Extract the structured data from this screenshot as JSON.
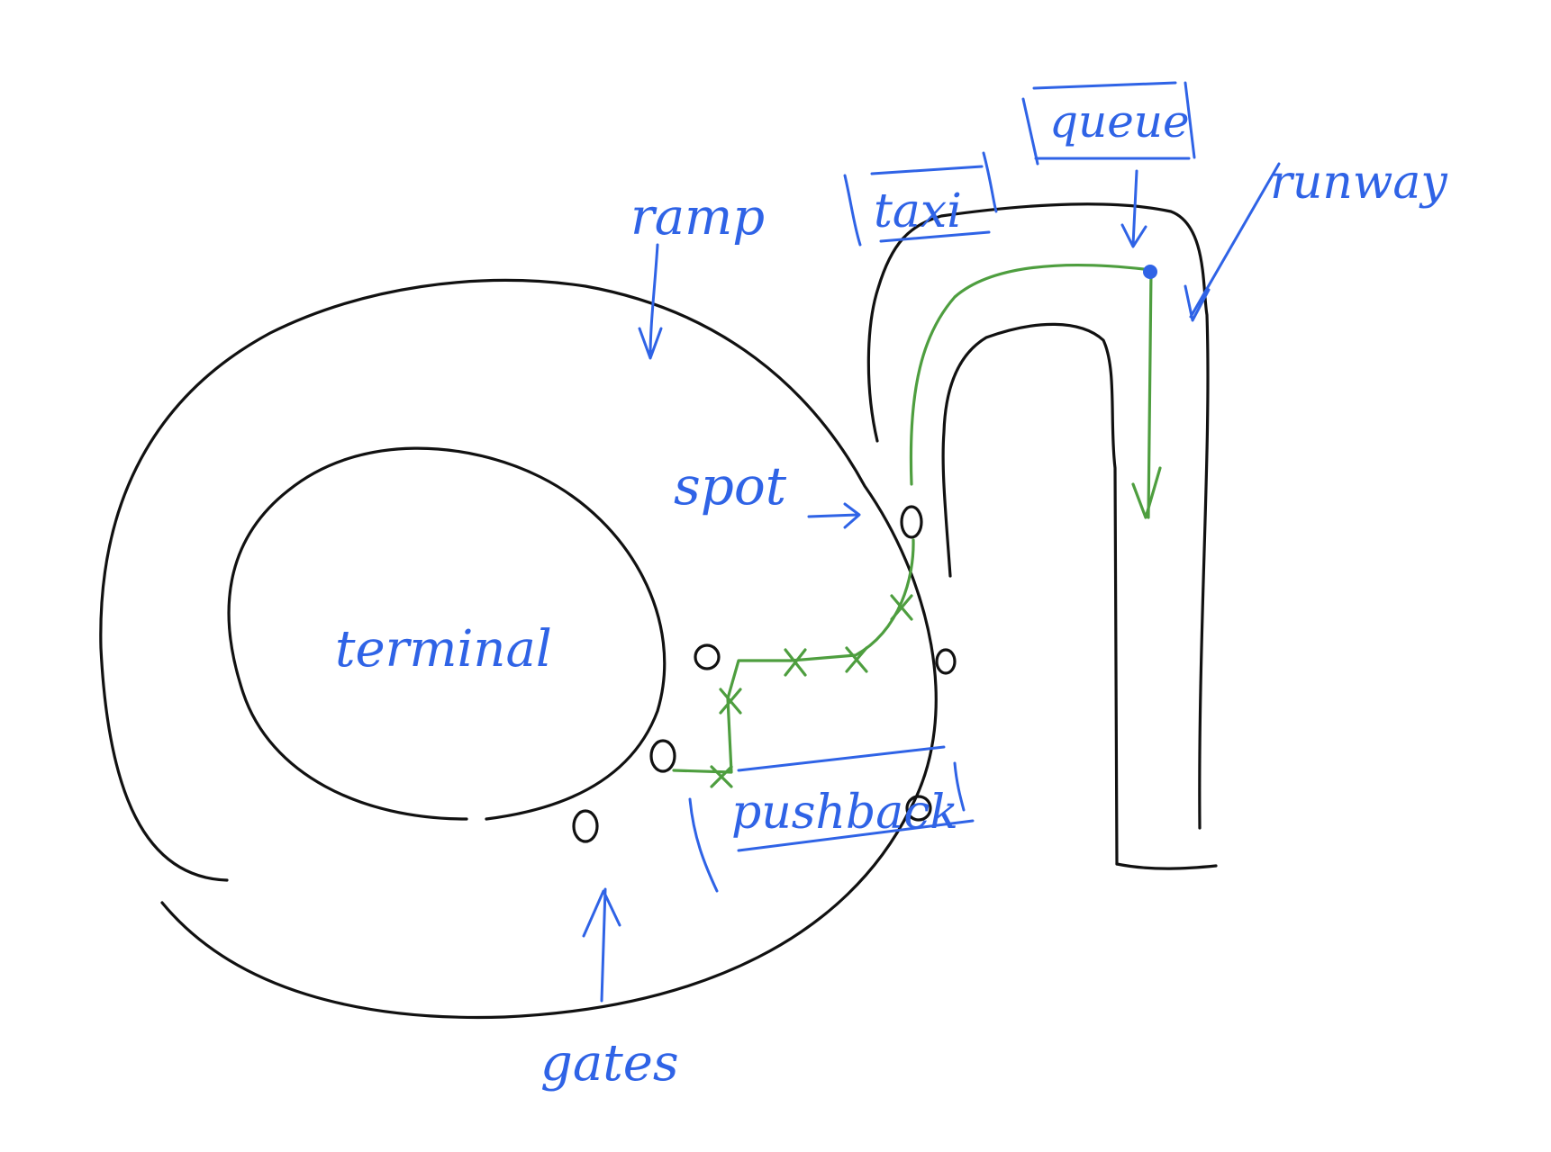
{
  "colors": {
    "outline": "#111111",
    "annotation": "#2f63e6",
    "route": "#4e9e3f"
  },
  "labels": {
    "ramp": "ramp",
    "taxi": "taxi",
    "queue": "queue",
    "runway": "runway",
    "spot": "spot",
    "terminal": "terminal",
    "pushback": "pushback",
    "gates": "gates"
  }
}
